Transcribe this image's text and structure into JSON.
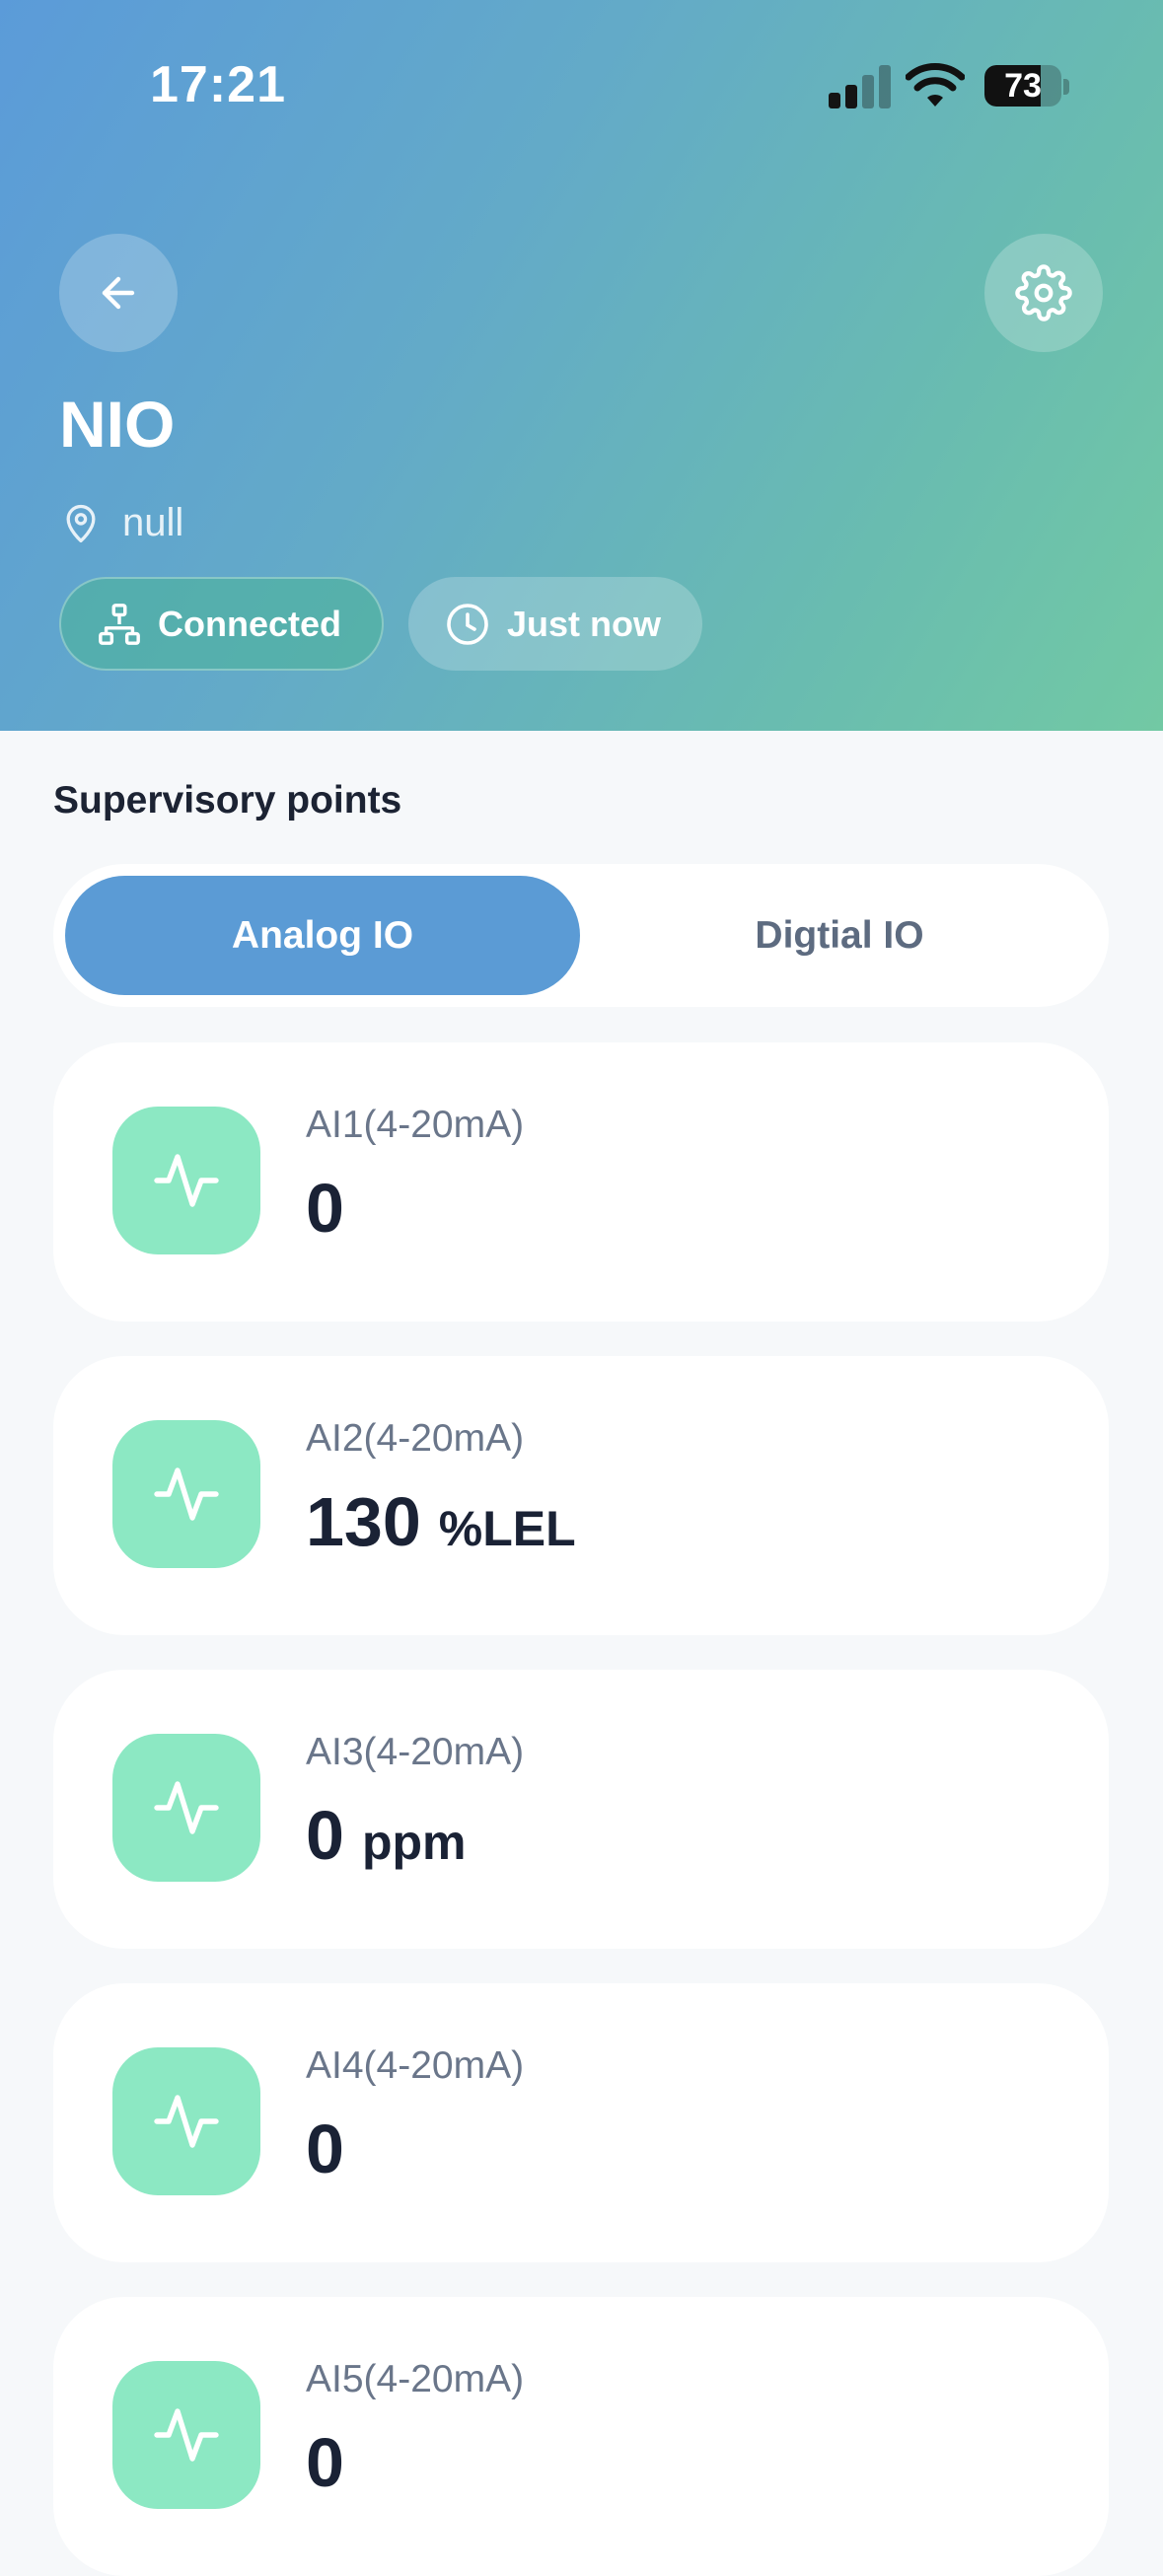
{
  "status_bar": {
    "time": "17:21",
    "battery_level": "73",
    "battery_fraction": 0.73,
    "signal_bars_active": 2,
    "signal_bars_total": 4
  },
  "header": {
    "back_icon": "arrow-left-icon",
    "settings_icon": "gear-icon",
    "device_name": "NIO",
    "location_icon": "map-pin-icon",
    "location": "null",
    "connection_icon": "network-icon",
    "connection_status": "Connected",
    "last_update_icon": "clock-icon",
    "last_update": "Just now"
  },
  "supervisory": {
    "title": "Supervisory points",
    "tabs": [
      {
        "label": "Analog IO",
        "active": true
      },
      {
        "label": "Digtial IO",
        "active": false
      }
    ],
    "points": [
      {
        "label": "AI1(4-20mA)",
        "value": "0",
        "unit": "",
        "icon": "activity-icon"
      },
      {
        "label": "AI2(4-20mA)",
        "value": "130",
        "unit": "%LEL",
        "icon": "activity-icon"
      },
      {
        "label": "AI3(4-20mA)",
        "value": "0",
        "unit": "ppm",
        "icon": "activity-icon"
      },
      {
        "label": "AI4(4-20mA)",
        "value": "0",
        "unit": "",
        "icon": "activity-icon"
      },
      {
        "label": "AI5(4-20mA)",
        "value": "0",
        "unit": "",
        "icon": "activity-icon"
      }
    ]
  },
  "colors": {
    "accent": "#5b9bd5",
    "icon_bg": "#8ce8c3",
    "header_gradient_start": "#5b9bd9",
    "header_gradient_end": "#72c9a4"
  }
}
